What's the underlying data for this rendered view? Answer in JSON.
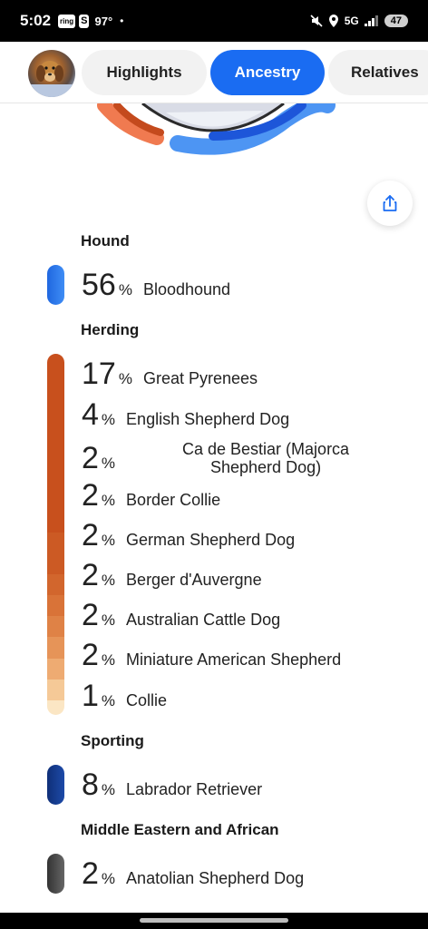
{
  "status_bar": {
    "time": "5:02",
    "badge_ring": "ring",
    "badge_s": "S",
    "temperature": "97°",
    "dot": "•",
    "network": "5G",
    "battery": "47"
  },
  "tabs": [
    {
      "label": "Highlights",
      "active": false
    },
    {
      "label": "Ancestry",
      "active": true
    },
    {
      "label": "Relatives",
      "active": false
    }
  ],
  "colors": {
    "accent": "#1a6cf2",
    "hound": "#2f7cf3",
    "herding": "#c8501d",
    "sporting": "#173d8f",
    "middle_eastern": "#555555"
  },
  "groups": [
    {
      "title": "Hound",
      "breeds": [
        {
          "percent": "56",
          "name": "Bloodhound"
        }
      ]
    },
    {
      "title": "Herding",
      "breeds": [
        {
          "percent": "17",
          "name": "Great Pyrenees"
        },
        {
          "percent": "4",
          "name": "English Shepherd Dog"
        },
        {
          "percent": "2",
          "name": "Ca de Bestiar (Majorca Shepherd Dog)"
        },
        {
          "percent": "2",
          "name": "Border Collie"
        },
        {
          "percent": "2",
          "name": "German Shepherd Dog"
        },
        {
          "percent": "2",
          "name": "Berger d'Auvergne"
        },
        {
          "percent": "2",
          "name": "Australian Cattle Dog"
        },
        {
          "percent": "2",
          "name": "Miniature American Shepherd"
        },
        {
          "percent": "1",
          "name": "Collie"
        }
      ]
    },
    {
      "title": "Sporting",
      "breeds": [
        {
          "percent": "8",
          "name": "Labrador Retriever"
        }
      ]
    },
    {
      "title": "Middle Eastern and African",
      "breeds": [
        {
          "percent": "2",
          "name": "Anatolian Shepherd Dog"
        }
      ]
    }
  ],
  "percent_sign": "%",
  "icons": {
    "share": "share-icon",
    "avatar": "dog-avatar"
  }
}
